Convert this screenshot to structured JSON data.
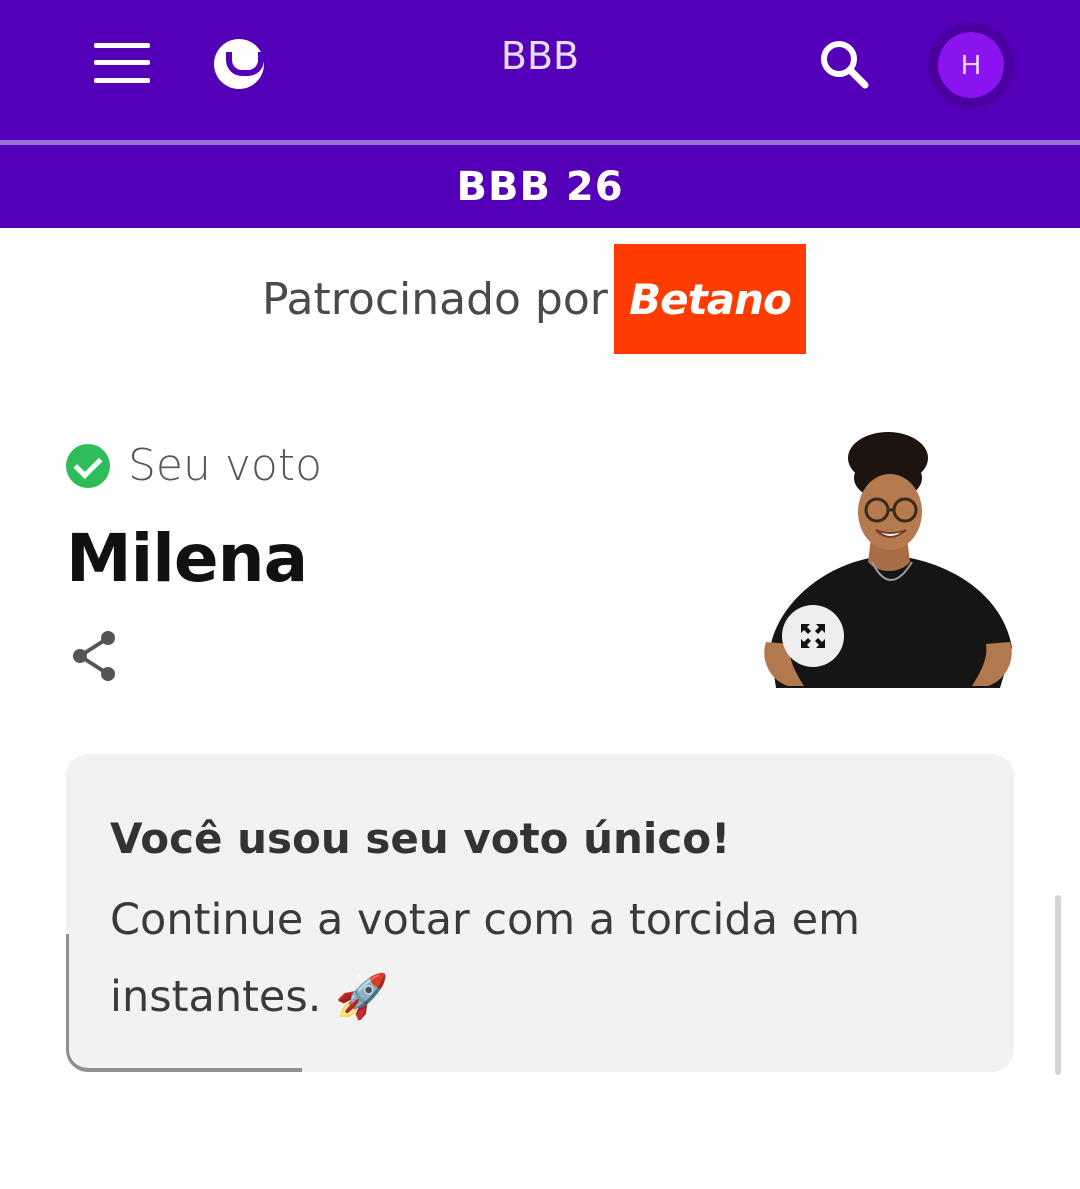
{
  "header": {
    "app_title": "BBB",
    "avatar_initial": "H",
    "section_title": "BBB 26"
  },
  "sponsor": {
    "label": "Patrocinado por",
    "brand": "Betano"
  },
  "vote": {
    "status_label": "Seu voto",
    "candidate": "Milena"
  },
  "card": {
    "title": "Você usou seu voto único!",
    "text": "Continue a votar com a torcida em instantes. 🚀"
  },
  "colors": {
    "brand_purple": "#5400b8",
    "sponsor_orange": "#ff3c00",
    "success_green": "#2ebd59"
  },
  "icons": [
    "menu-icon",
    "smile-icon",
    "search-icon",
    "check-icon",
    "share-icon",
    "expand-icon",
    "rocket-emoji"
  ]
}
